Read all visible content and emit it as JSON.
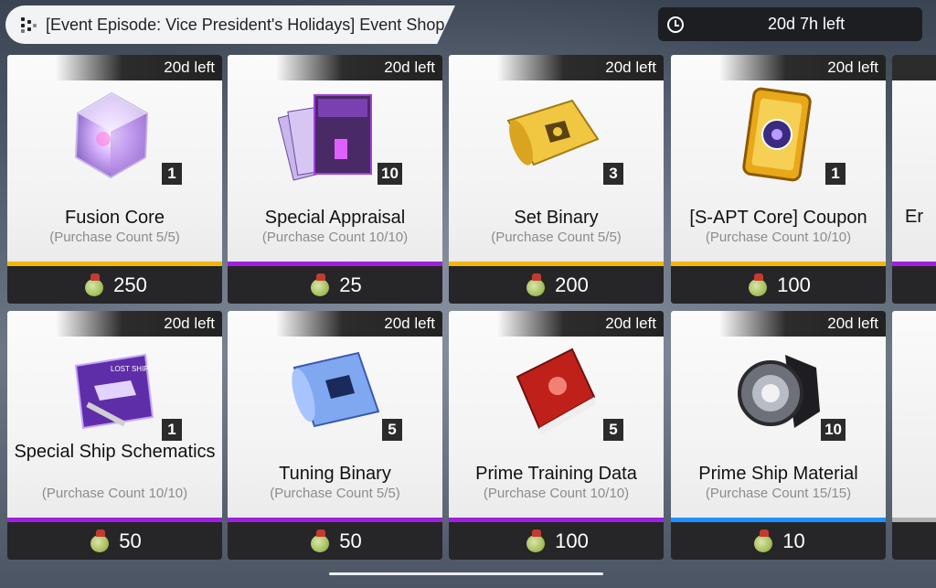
{
  "header": {
    "title": "[Event Episode: Vice President's Holidays] Event Shop",
    "icon": "dots-icon",
    "timer": "20d 7h left",
    "timer_icon": "clock-icon"
  },
  "currency_icon": "fruit-coin-icon",
  "items": [
    {
      "tag": "20d left",
      "name": "Fusion Core",
      "count": "(Purchase Count 5/5)",
      "qty": "1",
      "price": "250",
      "rarity": "#f2b705",
      "icon": "crystal-cube-icon"
    },
    {
      "tag": "20d left",
      "name": "Special Appraisal",
      "count": "(Purchase Count 10/10)",
      "qty": "10",
      "price": "25",
      "rarity": "#a020e0",
      "icon": "purple-folder-icon"
    },
    {
      "tag": "20d left",
      "name": "Set Binary",
      "count": "(Purchase Count 5/5)",
      "qty": "3",
      "price": "200",
      "rarity": "#f2b705",
      "icon": "gold-scroll-icon"
    },
    {
      "tag": "20d left",
      "name": "[S-APT Core] Coupon",
      "count": "(Purchase Count 10/10)",
      "qty": "1",
      "price": "100",
      "rarity": "#f2b705",
      "icon": "gold-coupon-icon"
    },
    {
      "tag": "20d left",
      "name": "Special Ship Schematics",
      "count": "(Purchase Count 10/10)",
      "qty": "1",
      "price": "50",
      "rarity": "#a020e0",
      "icon": "ship-schematic-icon"
    },
    {
      "tag": "20d left",
      "name": "Tuning Binary",
      "count": "(Purchase Count 5/5)",
      "qty": "5",
      "price": "50",
      "rarity": "#a020e0",
      "icon": "blue-scroll-icon"
    },
    {
      "tag": "20d left",
      "name": "Prime Training Data",
      "count": "(Purchase Count 10/10)",
      "qty": "5",
      "price": "100",
      "rarity": "#a020e0",
      "icon": "red-book-icon"
    },
    {
      "tag": "20d left",
      "name": "Prime Ship Material",
      "count": "(Purchase Count 15/15)",
      "qty": "10",
      "price": "10",
      "rarity": "#1e90ff",
      "icon": "metal-gear-icon"
    }
  ],
  "peek": {
    "label": "Er"
  }
}
